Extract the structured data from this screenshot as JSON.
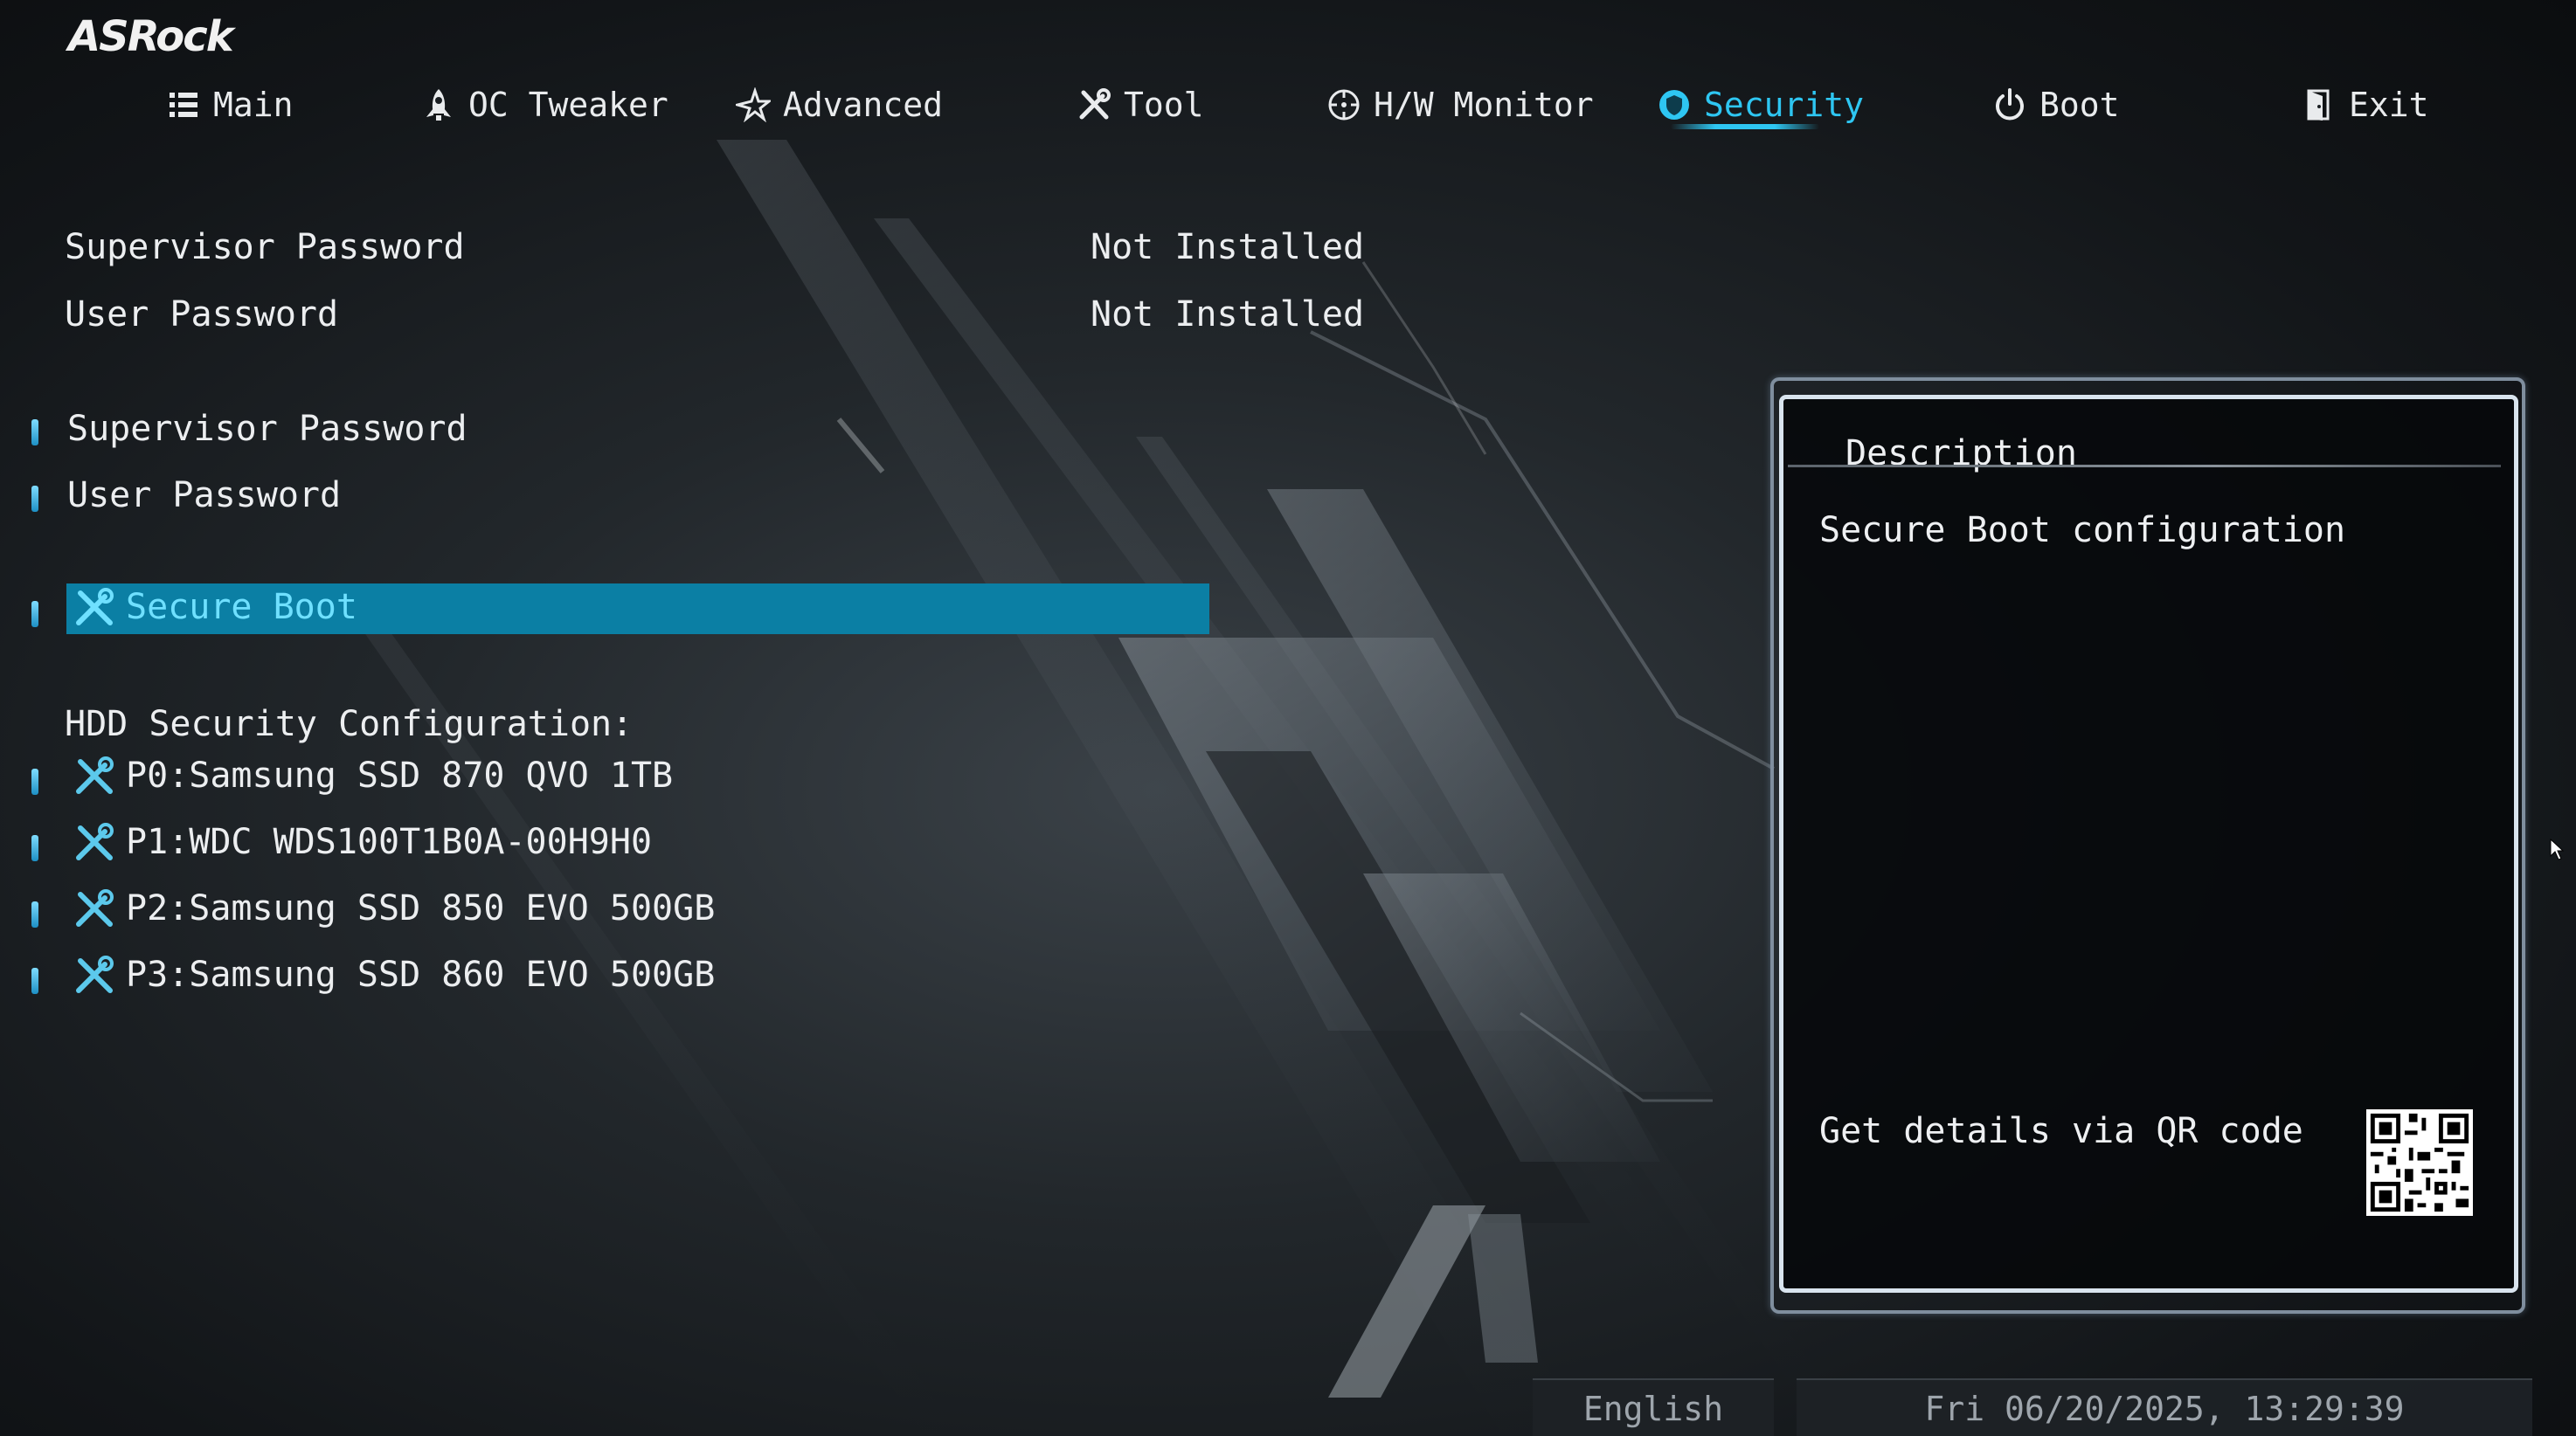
{
  "brand": {
    "logo_text": "ASRock"
  },
  "nav": {
    "tabs": [
      {
        "label": "Main",
        "icon": "list-icon"
      },
      {
        "label": "OC Tweaker",
        "icon": "rocket-icon"
      },
      {
        "label": "Advanced",
        "icon": "star-icon"
      },
      {
        "label": "Tool",
        "icon": "tools-icon"
      },
      {
        "label": "H/W Monitor",
        "icon": "monitor-icon"
      },
      {
        "label": "Security",
        "icon": "shield-icon",
        "active": true
      },
      {
        "label": "Boot",
        "icon": "power-icon"
      },
      {
        "label": "Exit",
        "icon": "exit-door-icon"
      }
    ],
    "accent_color": "#2ec6f2"
  },
  "status": [
    {
      "label": "Supervisor Password",
      "value": "Not Installed"
    },
    {
      "label": "User Password",
      "value": "Not Installed"
    }
  ],
  "password_items": [
    {
      "label": "Supervisor Password"
    },
    {
      "label": "User Password"
    }
  ],
  "secure_boot": {
    "label": "Secure Boot",
    "selected": true,
    "highlight_color": "#0b7fa4"
  },
  "hdd": {
    "heading": "HDD Security Configuration:",
    "drives": [
      {
        "label": "P0:Samsung SSD 870 QVO 1TB"
      },
      {
        "label": "P1:WDC WDS100T1B0A-00H9H0"
      },
      {
        "label": "P2:Samsung SSD 850 EVO 500GB"
      },
      {
        "label": "P3:Samsung SSD 860 EVO 500GB"
      }
    ]
  },
  "description": {
    "title": "Description",
    "text": "Secure Boot configuration",
    "qr_label": "Get details via QR code"
  },
  "footer": {
    "language": "English",
    "datetime": "Fri 06/20/2025, 13:29:39"
  }
}
